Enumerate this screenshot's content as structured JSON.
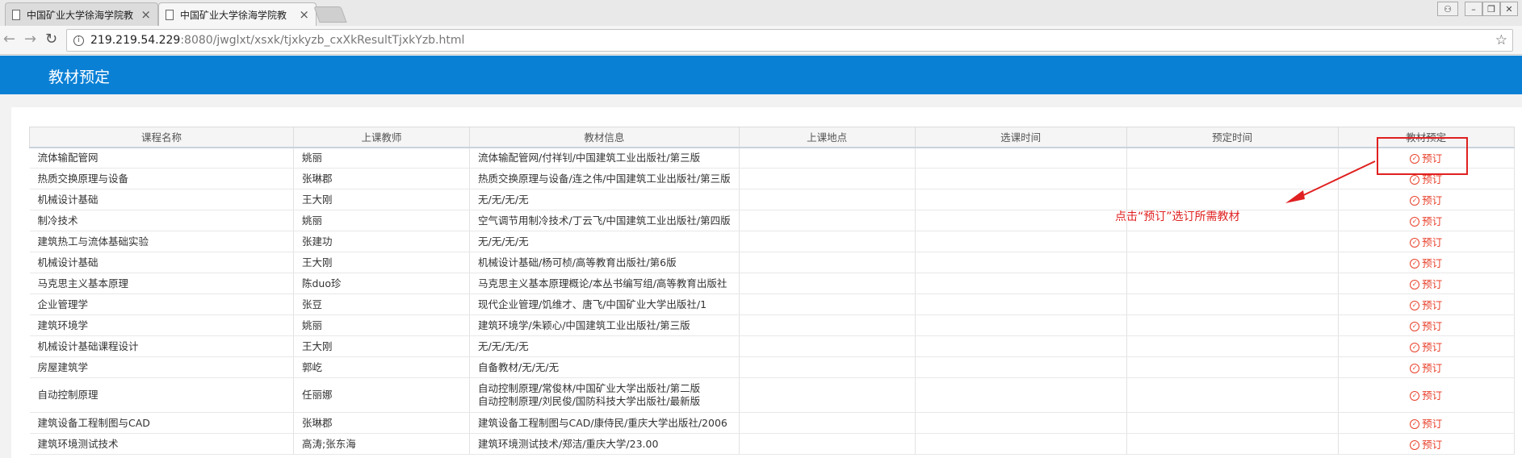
{
  "browser": {
    "tabs": [
      {
        "title": "中国矿业大学徐海学院教"
      },
      {
        "title": "中国矿业大学徐海学院教"
      }
    ],
    "url_host": "219.219.54.229",
    "url_path": ":8080/jwglxt/xsxk/tjxkyzb_cxXkResultTjxkYzb.html"
  },
  "header": {
    "title": "教材预定"
  },
  "table": {
    "columns": [
      "课程名称",
      "上课教师",
      "教材信息",
      "上课地点",
      "选课时间",
      "预定时间",
      "教材预定"
    ],
    "action_label": "预订",
    "rows": [
      {
        "course": "流体输配管网",
        "teacher": "姚丽",
        "book": "流体输配管网/付祥钊/中国建筑工业出版社/第三版",
        "book2": ""
      },
      {
        "course": "热质交换原理与设备",
        "teacher": "张琳郡",
        "book": "热质交换原理与设备/连之伟/中国建筑工业出版社/第三版",
        "book2": ""
      },
      {
        "course": "机械设计基础",
        "teacher": "王大刚",
        "book": "无/无/无/无",
        "book2": ""
      },
      {
        "course": "制冷技术",
        "teacher": "姚丽",
        "book": "空气调节用制冷技术/丁云飞/中国建筑工业出版社/第四版",
        "book2": ""
      },
      {
        "course": "建筑热工与流体基础实验",
        "teacher": "张建功",
        "book": "无/无/无/无",
        "book2": ""
      },
      {
        "course": "机械设计基础",
        "teacher": "王大刚",
        "book": "机械设计基础/杨可桢/高等教育出版社/第6版",
        "book2": ""
      },
      {
        "course": "马克思主义基本原理",
        "teacher": "陈duo珍",
        "book": "马克思主义基本原理概论/本丛书编写组/高等教育出版社",
        "book2": ""
      },
      {
        "course": "企业管理学",
        "teacher": "张豆",
        "book": "现代企业管理/饥维才、唐飞/中国矿业大学出版社/1",
        "book2": ""
      },
      {
        "course": "建筑环境学",
        "teacher": "姚丽",
        "book": "建筑环境学/朱颖心/中国建筑工业出版社/第三版",
        "book2": ""
      },
      {
        "course": "机械设计基础课程设计",
        "teacher": "王大刚",
        "book": "无/无/无/无",
        "book2": ""
      },
      {
        "course": "房屋建筑学",
        "teacher": "郭屹",
        "book": "自备教材/无/无/无",
        "book2": ""
      },
      {
        "course": "自动控制原理",
        "teacher": "任丽娜",
        "book": "自动控制原理/常俊林/中国矿业大学出版社/第二版",
        "book2": "自动控制原理/刘民俊/国防科技大学出版社/最新版"
      },
      {
        "course": "建筑设备工程制图与CAD",
        "teacher": "张琳郡",
        "book": "建筑设备工程制图与CAD/康侍民/重庆大学出版社/2006",
        "book2": ""
      },
      {
        "course": "建筑环境测试技术",
        "teacher": "高涛;张东海",
        "book": "建筑环境测试技术/郑洁/重庆大学/23.00",
        "book2": ""
      }
    ]
  },
  "annotation": {
    "text": "点击“预订”选订所需教材",
    "color": "#e02020"
  },
  "colors": {
    "header": "#0a80d5",
    "action": "#e8402a"
  },
  "icons": [
    "document-icon",
    "close-icon",
    "back-icon",
    "forward-icon",
    "reload-icon",
    "info-icon",
    "star-icon",
    "check-circle-icon",
    "user-icon",
    "minimize-icon",
    "restore-icon",
    "window-close-icon"
  ]
}
